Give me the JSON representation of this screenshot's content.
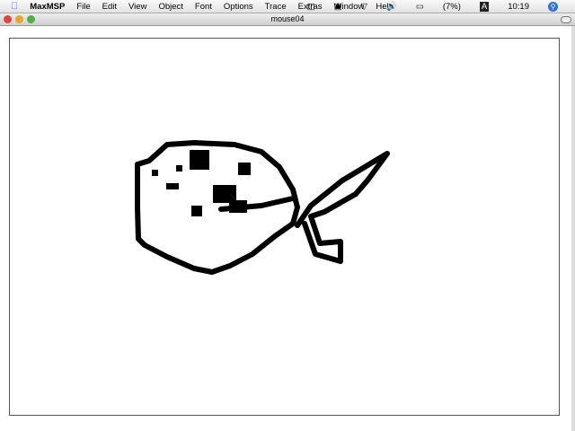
{
  "menubar": {
    "app": "MaxMSP",
    "items": [
      "File",
      "Edit",
      "View",
      "Object",
      "Font",
      "Options",
      "Trace",
      "Extras",
      "Window",
      "Help"
    ],
    "battery": "(7%)",
    "clock": "10:19"
  },
  "window": {
    "title": "mouse04"
  },
  "colors": {
    "stroke": "#000000",
    "close": "#e0443e",
    "minimize": "#e8a72a",
    "zoom": "#52b043"
  }
}
